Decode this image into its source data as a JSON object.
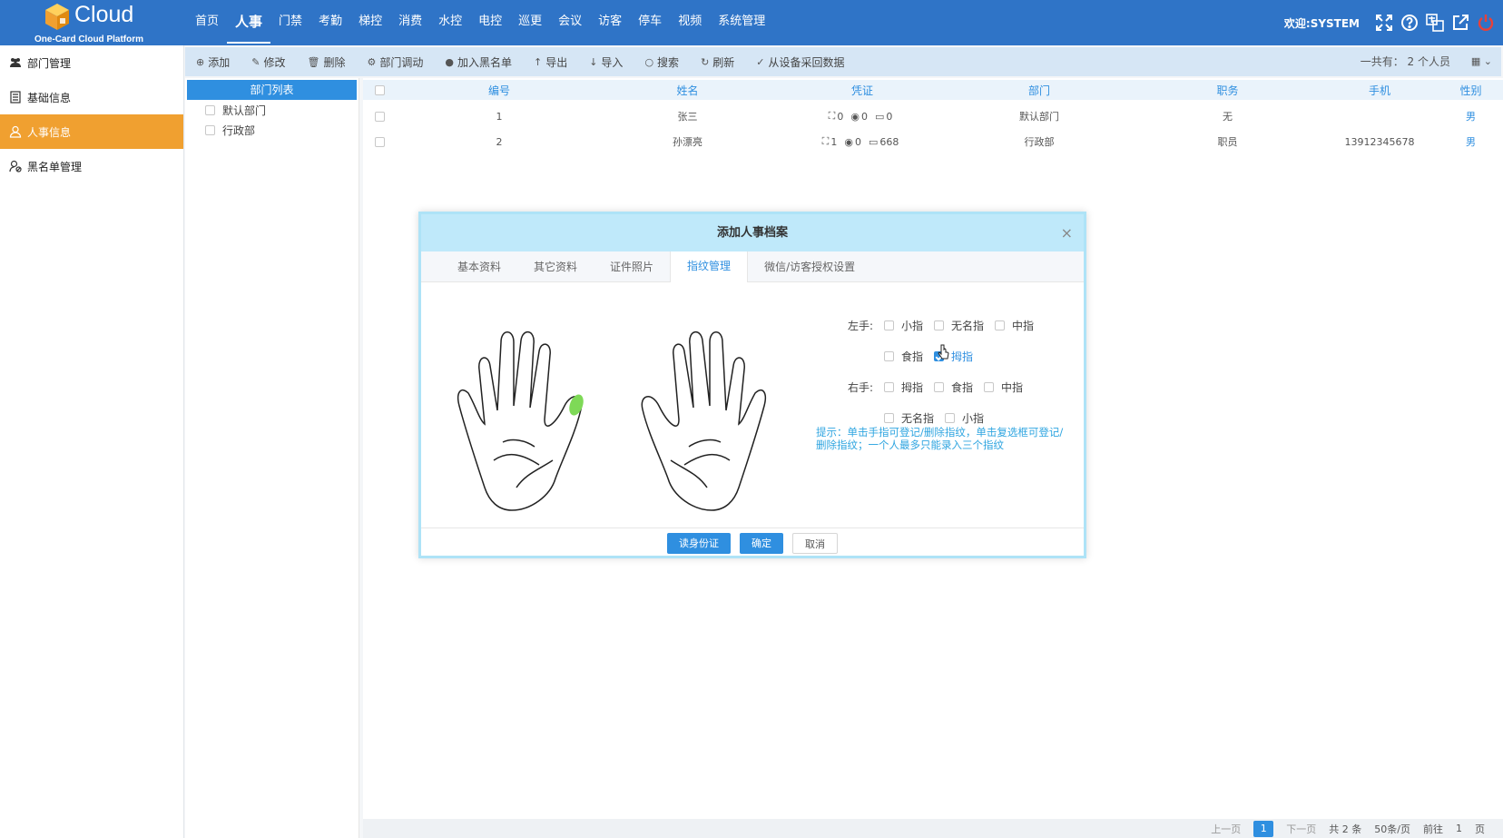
{
  "app": {
    "brand": "Cloud",
    "subtitle": "One-Card Cloud Platform",
    "welcome": "欢迎:SYSTEM",
    "accent": "#2f74c7",
    "nav": [
      "首页",
      "人事",
      "门禁",
      "考勤",
      "梯控",
      "消费",
      "水控",
      "电控",
      "巡更",
      "会议",
      "访客",
      "停车",
      "视频",
      "系统管理"
    ],
    "nav_active": "人事"
  },
  "sidebar": {
    "items": [
      {
        "label": "部门管理",
        "icon": "group-icon"
      },
      {
        "label": "基础信息",
        "icon": "document-icon"
      },
      {
        "label": "人事信息",
        "icon": "user-icon",
        "active": true
      },
      {
        "label": "黑名单管理",
        "icon": "user-block-icon"
      }
    ]
  },
  "toolbar": {
    "add": "添加",
    "edit": "修改",
    "delete": "删除",
    "transfer": "部门调动",
    "blacklist": "加入黑名单",
    "export": "导出",
    "import": "导入",
    "search": "搜索",
    "refresh": "刷新",
    "collect": "从设备采回数据",
    "total": "一共有： 2 个人员"
  },
  "dept": {
    "header": "部门列表",
    "items": [
      "默认部门",
      "行政部"
    ]
  },
  "table": {
    "headers": [
      "编号",
      "姓名",
      "凭证",
      "部门",
      "职务",
      "手机",
      "性别"
    ],
    "rows": [
      {
        "id": "1",
        "name": "张三",
        "face": "0",
        "finger": "0",
        "card": "0",
        "dept": "默认部门",
        "title": "无",
        "phone": "",
        "gender": "男"
      },
      {
        "id": "2",
        "name": "孙漂亮",
        "face": "1",
        "finger": "0",
        "card": "668",
        "dept": "行政部",
        "title": "职员",
        "phone": "13912345678",
        "gender": "男"
      }
    ]
  },
  "pager": {
    "prev": "上一页",
    "current": "1",
    "next": "下一页",
    "total": "共 2 条",
    "size": "50条/页",
    "goto_label": "前往",
    "goto_value": "1",
    "page_unit": "页"
  },
  "modal": {
    "title": "添加人事档案",
    "tabs": [
      "基本资料",
      "其它资料",
      "证件照片",
      "指纹管理",
      "微信/访客授权设置"
    ],
    "active_tab": "指纹管理",
    "left_label": "左手:",
    "right_label": "右手:",
    "left_row1": [
      "小指",
      "无名指",
      "中指"
    ],
    "left_row2": [
      "食指",
      "拇指"
    ],
    "right_row1": [
      "拇指",
      "食指",
      "中指"
    ],
    "right_row2": [
      "无名指",
      "小指"
    ],
    "checked": "左手拇指",
    "hint": "提示：单击手指可登记/删除指纹，单击复选框可登记/删除指纹；一个人最多只能录入三个指纹",
    "btn_read_id": "读身份证",
    "btn_ok": "确定",
    "btn_cancel": "取消",
    "highlight_color": "#7ed957"
  }
}
